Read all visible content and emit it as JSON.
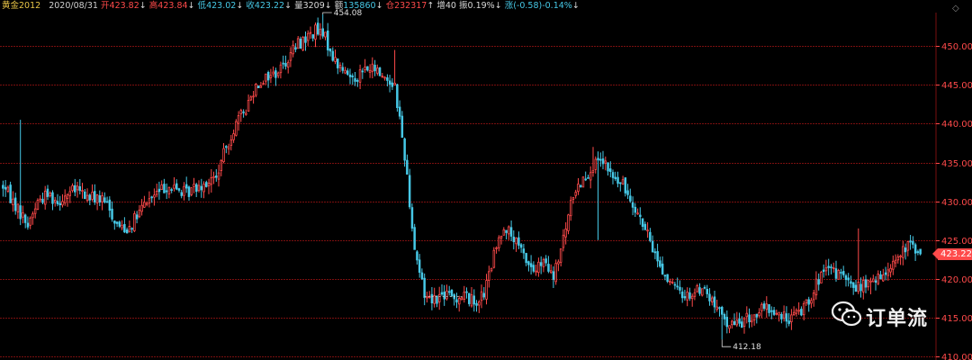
{
  "header": {
    "symbol": "黄金2012",
    "date": "2020/08/31",
    "open_label": "开",
    "open": "423.82",
    "open_arrow": "↓",
    "high_label": "高",
    "high": "423.84",
    "high_arrow": "↓",
    "low_label": "低",
    "low": "423.02",
    "low_arrow": "↓",
    "close_label": "收",
    "close": "423.22",
    "close_arrow": "↓",
    "vol_label": "量",
    "vol": "3209",
    "vol_arrow": "↓",
    "amt_label": "额",
    "amt": "135860",
    "amt_arrow": "↓",
    "oi_label": "仓",
    "oi": "232317",
    "oi_arrow": "↑",
    "chg_oi_label": "增",
    "chg_oi": "40",
    "amp_label": "振",
    "amp": "0.19%",
    "amp_arrow": "↓",
    "chg_label": "涨",
    "chg": "(-0.58)-0.14%",
    "chg_arrow": "↓"
  },
  "watermark": {
    "text": "订单流",
    "icon": "wechat-icon"
  },
  "last_price_tag": "423.22",
  "colors": {
    "up": "#ff4a4a",
    "down": "#46c8e6",
    "grid": "#7a0f0f",
    "bg": "#000000"
  },
  "chart_data": {
    "type": "candlestick",
    "y_axis": {
      "side": "right",
      "ylim": [
        410,
        455
      ],
      "ticks": [
        "410.00",
        "415.00",
        "420.00",
        "425.00",
        "430.00",
        "435.00",
        "440.00",
        "445.00",
        "450.00"
      ],
      "tick_values": [
        410,
        415,
        420,
        425,
        430,
        435,
        440,
        445,
        450
      ]
    },
    "grid": true,
    "annotations": [
      {
        "label": "454.08",
        "value": 454.08,
        "kind": "high"
      },
      {
        "label": "412.18",
        "value": 412.18,
        "kind": "low"
      }
    ],
    "last_price": 423.22,
    "anchors": [
      [
        0,
        432
      ],
      [
        6,
        429
      ],
      [
        10,
        427
      ],
      [
        14,
        430
      ],
      [
        18,
        431
      ],
      [
        22,
        430
      ],
      [
        26,
        431
      ],
      [
        30,
        431.5
      ],
      [
        34,
        430.5
      ],
      [
        38,
        430.5
      ],
      [
        42,
        429.5
      ],
      [
        46,
        427
      ],
      [
        50,
        426.5
      ],
      [
        54,
        428
      ],
      [
        58,
        430
      ],
      [
        62,
        431
      ],
      [
        66,
        432
      ],
      [
        70,
        431.5
      ],
      [
        74,
        431
      ],
      [
        78,
        432
      ],
      [
        82,
        432.5
      ],
      [
        86,
        433
      ],
      [
        90,
        437
      ],
      [
        94,
        440
      ],
      [
        98,
        442
      ],
      [
        102,
        445
      ],
      [
        106,
        446
      ],
      [
        110,
        446.5
      ],
      [
        114,
        448
      ],
      [
        118,
        450
      ],
      [
        122,
        451
      ],
      [
        126,
        452
      ],
      [
        130,
        451
      ],
      [
        134,
        448
      ],
      [
        138,
        446.5
      ],
      [
        142,
        446
      ],
      [
        146,
        447
      ],
      [
        150,
        447
      ],
      [
        154,
        446
      ],
      [
        158,
        445
      ],
      [
        162,
        436
      ],
      [
        166,
        424
      ],
      [
        170,
        418
      ],
      [
        174,
        417.5
      ],
      [
        178,
        418
      ],
      [
        182,
        417.5
      ],
      [
        186,
        418
      ],
      [
        190,
        417
      ],
      [
        194,
        418
      ],
      [
        198,
        423
      ],
      [
        202,
        427
      ],
      [
        206,
        425
      ],
      [
        210,
        423
      ],
      [
        214,
        421
      ],
      [
        218,
        422
      ],
      [
        222,
        420
      ],
      [
        226,
        425
      ],
      [
        230,
        431
      ],
      [
        234,
        433
      ],
      [
        238,
        434.5
      ],
      [
        242,
        435
      ],
      [
        246,
        433
      ],
      [
        250,
        432
      ],
      [
        254,
        430
      ],
      [
        258,
        427
      ],
      [
        262,
        424
      ],
      [
        266,
        421
      ],
      [
        270,
        419
      ],
      [
        274,
        418
      ],
      [
        278,
        418
      ],
      [
        282,
        419
      ],
      [
        286,
        417
      ],
      [
        290,
        415
      ],
      [
        294,
        414
      ],
      [
        298,
        414.5
      ],
      [
        302,
        415
      ],
      [
        306,
        416
      ],
      [
        310,
        416
      ],
      [
        314,
        415
      ],
      [
        318,
        415
      ],
      [
        322,
        416
      ],
      [
        326,
        418
      ],
      [
        330,
        420.5
      ],
      [
        334,
        421
      ],
      [
        338,
        420.5
      ],
      [
        342,
        419
      ],
      [
        346,
        419
      ],
      [
        350,
        419.5
      ],
      [
        354,
        420
      ],
      [
        358,
        422
      ],
      [
        362,
        423
      ],
      [
        366,
        424.5
      ],
      [
        370,
        423.5
      ]
    ],
    "sample_candles": {
      "count": 371,
      "high_index": 129,
      "low_index": 290,
      "spikes_up": [
        [
          7,
          440.5
        ],
        [
          158,
          449.5
        ],
        [
          238,
          437
        ],
        [
          345,
          426.5
        ]
      ],
      "spikes_down": [
        [
          163,
          434.5
        ],
        [
          240,
          425
        ],
        [
          350,
          418
        ]
      ]
    }
  }
}
